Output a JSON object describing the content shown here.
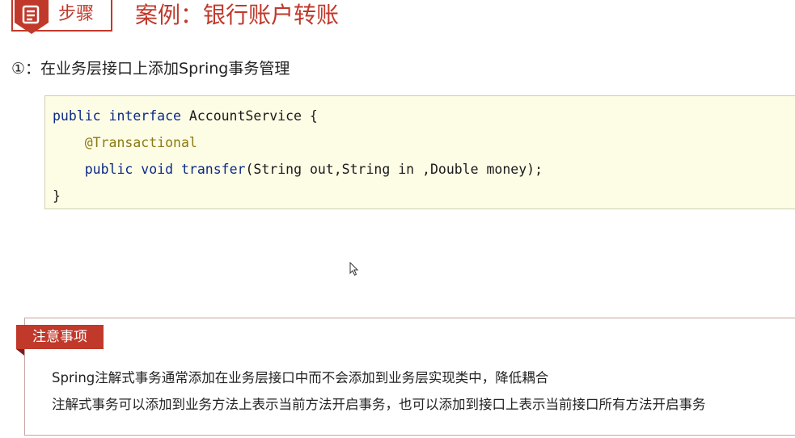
{
  "header": {
    "step_label": "步骤",
    "title": "案例：银行账户转账",
    "icon": "document-list-icon"
  },
  "step": {
    "number": "①：",
    "text": "在业务层接口上添加Spring事务管理"
  },
  "code": {
    "line1": {
      "kw1": "public",
      "kw2": "interface",
      "rest": "AccountService {"
    },
    "line2": {
      "annotation": "@Transactional"
    },
    "line3": {
      "kw1": "public",
      "kw2": "void",
      "method": "transfer",
      "rest": "(String out,String in ,Double money);"
    },
    "line4": "}"
  },
  "note": {
    "tag": "注意事项",
    "lines": [
      "Spring注解式事务通常添加在业务层接口中而不会添加到业务层实现类中，降低耦合",
      "注解式事务可以添加到业务方法上表示当前方法开启事务，也可以添加到接口上表示当前接口所有方法开启事务"
    ]
  },
  "colors": {
    "accent": "#c0392b",
    "code_background": "#fdfde6",
    "keyword": "#0b2a86",
    "annotation": "#8b7a12"
  }
}
